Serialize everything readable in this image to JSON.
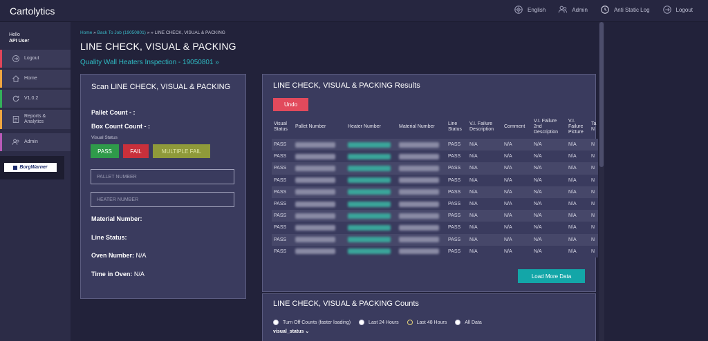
{
  "app": {
    "title": "Cartolytics"
  },
  "topnav": [
    {
      "label": "English",
      "icon": "globe-icon"
    },
    {
      "label": "Admin",
      "icon": "user-group-icon"
    },
    {
      "label": "Anti Static Log",
      "icon": "clock-icon"
    },
    {
      "label": "Logout",
      "icon": "logout-icon"
    }
  ],
  "sidebar": {
    "greeting": "Hello",
    "user": "API User",
    "items": [
      {
        "label": "Logout",
        "accent": "#e0455a",
        "icon": "logout-icon"
      },
      {
        "label": "Home",
        "accent": "#f0a640",
        "icon": "home-icon"
      },
      {
        "label": "V1.0.2",
        "accent": "#33b05a",
        "icon": "refresh-icon"
      },
      {
        "label": "Reports & Analytics",
        "accent": "#f0a640",
        "icon": "report-icon"
      },
      {
        "label": "Admin",
        "accent": "#b85ab8",
        "icon": "user-group-icon"
      }
    ],
    "logo": "BorgWarner"
  },
  "breadcrumb": {
    "home": "Home",
    "sep1": " » ",
    "back": "Back To Job (19050801)",
    "sep2": " » » ",
    "current": "LINE CHECK, VISUAL & PACKING"
  },
  "page": {
    "title": "LINE CHECK, VISUAL & PACKING",
    "sublink": "Quality Wall Heaters Inspection - 19050801 »"
  },
  "scan": {
    "title": "Scan LINE CHECK, VISUAL & PACKING",
    "pallet_count": "Pallet Count - :",
    "box_count": "Box Count Count - :",
    "visual_status_label": "Visual Status",
    "pass_label": "PASS",
    "fail_label": "FAIL",
    "multi_fail_label": "MULTIPLE FAIL",
    "pallet_placeholder": "PALLET NUMBER",
    "heater_placeholder": "HEATER NUMBER",
    "material_label": "Material Number:",
    "line_status_label": "Line Status:",
    "oven_label": "Oven Number:",
    "oven_value": " N/A",
    "time_label": "Time in Oven:",
    "time_value": " N/A"
  },
  "results": {
    "title": "LINE CHECK, VISUAL & PACKING Results",
    "undo_label": "Undo",
    "load_more_label": "Load More Data",
    "columns": [
      "Visual Status",
      "Pallet Number",
      "Heater Number",
      "Material Number",
      "Line Status",
      "V.I. Failure Description",
      "Comment",
      "V.I. Failure 2nd Description",
      "V.I. Failure Picture",
      "Ta N"
    ],
    "rows": [
      [
        "PASS",
        "PASS",
        "N/A",
        "N/A",
        "N/A",
        "N/A",
        "N"
      ],
      [
        "PASS",
        "PASS",
        "N/A",
        "N/A",
        "N/A",
        "N/A",
        "N"
      ],
      [
        "PASS",
        "PASS",
        "N/A",
        "N/A",
        "N/A",
        "N/A",
        "N"
      ],
      [
        "PASS",
        "PASS",
        "N/A",
        "N/A",
        "N/A",
        "N/A",
        "N"
      ],
      [
        "PASS",
        "PASS",
        "N/A",
        "N/A",
        "N/A",
        "N/A",
        "N"
      ],
      [
        "PASS",
        "PASS",
        "N/A",
        "N/A",
        "N/A",
        "N/A",
        "N"
      ],
      [
        "PASS",
        "PASS",
        "N/A",
        "N/A",
        "N/A",
        "N/A",
        "N"
      ],
      [
        "PASS",
        "PASS",
        "N/A",
        "N/A",
        "N/A",
        "N/A",
        "N"
      ],
      [
        "PASS",
        "PASS",
        "N/A",
        "N/A",
        "N/A",
        "N/A",
        "N"
      ],
      [
        "PASS",
        "PASS",
        "N/A",
        "N/A",
        "N/A",
        "N/A",
        "N"
      ]
    ]
  },
  "counts": {
    "title": "LINE CHECK, VISUAL & PACKING Counts",
    "options": [
      {
        "label": "Turn Off Counts (faster loading)",
        "selected": false
      },
      {
        "label": "Last 24 Hours",
        "selected": false
      },
      {
        "label": "Last 48 Hours",
        "selected": true
      },
      {
        "label": "All Data",
        "selected": false
      }
    ],
    "select_value": "visual_status"
  }
}
